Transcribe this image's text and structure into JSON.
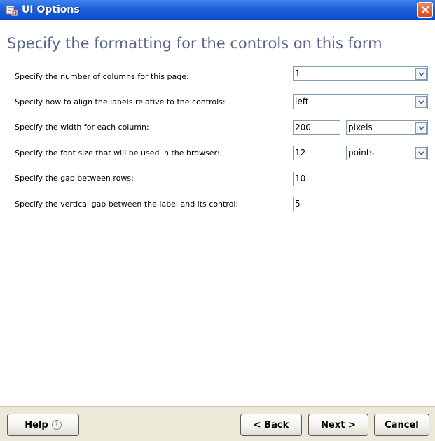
{
  "window": {
    "title": "UI Options",
    "close_label": "×"
  },
  "heading": "Specify the formatting for the controls on this form",
  "form": {
    "columns": {
      "label": "Specify the number of columns for this page:",
      "value": "1"
    },
    "align": {
      "label": "Specify how to align the labels relative to the controls:",
      "value": "left"
    },
    "width": {
      "label": "Specify the width for each column:",
      "value": "200",
      "unit": "pixels"
    },
    "font_size": {
      "label": "Specify the font size that will be used in the browser:",
      "value": "12",
      "unit": "points"
    },
    "row_gap": {
      "label": "Specify the gap between rows:",
      "value": "10"
    },
    "vertical_gap": {
      "label": "Specify the vertical gap between the label and its control:",
      "value": "5"
    }
  },
  "buttons": {
    "help": "Help",
    "help_icon": "?",
    "back": "< Back",
    "next": "Next >",
    "cancel": "Cancel"
  },
  "colors": {
    "titlebar": "#0a4ecb",
    "heading": "#58648a",
    "close": "#d9461f",
    "footer": "#ece9d8"
  },
  "icons": {
    "app": "app-icon",
    "close": "close-icon",
    "dropdown": "chevron-down-icon",
    "help": "question-circle-icon"
  }
}
